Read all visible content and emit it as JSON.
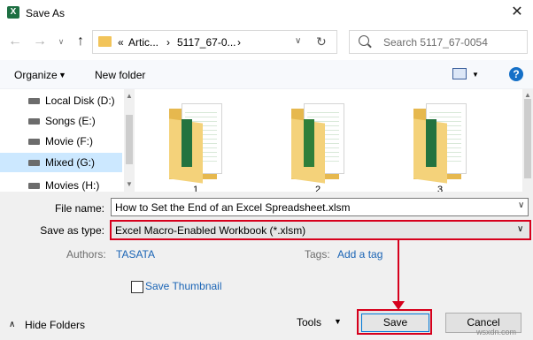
{
  "window": {
    "title": "Save As",
    "app_icon": "excel-icon",
    "close": "✕"
  },
  "nav": {
    "back": "←",
    "forward": "→",
    "recent_caret": "∨",
    "up": "↑",
    "breadcrumb": [
      "«",
      "Artic...",
      "›",
      "5117_67-0...",
      "›"
    ],
    "address_dropdown": "∨",
    "refresh": "↻",
    "search_placeholder": "Search 5117_67-0054"
  },
  "toolbar": {
    "organize": "Organize",
    "organize_caret": "▼",
    "new_folder": "New folder",
    "view_caret": "▼",
    "help": "?"
  },
  "sidebar": {
    "items": [
      {
        "label": "Local Disk (D:)",
        "icon": "drive-icon"
      },
      {
        "label": "Songs (E:)",
        "icon": "drive-icon"
      },
      {
        "label": "Movie (F:)",
        "icon": "drive-icon"
      },
      {
        "label": "Mixed (G:)",
        "icon": "drive-icon",
        "selected": true
      },
      {
        "label": "Movies (H:)",
        "icon": "drive-icon"
      }
    ]
  },
  "files": [
    {
      "label": "1"
    },
    {
      "label": "2"
    },
    {
      "label": "3"
    }
  ],
  "form": {
    "file_name_label": "File name:",
    "file_name_value": "How to Set the End of an Excel Spreadsheet.xlsm",
    "save_type_label": "Save as type:",
    "save_type_value": "Excel Macro-Enabled Workbook (*.xlsm)",
    "authors_label": "Authors:",
    "authors_value": "TASATA",
    "tags_label": "Tags:",
    "tags_value": "Add a tag",
    "save_thumbnail_label": "Save Thumbnail",
    "save_thumbnail_checked": false
  },
  "footer": {
    "hide_folders_caret": "∧",
    "hide_folders": "Hide Folders",
    "tools": "Tools",
    "tools_caret": "▼",
    "save": "Save",
    "cancel": "Cancel"
  },
  "watermark": "wsxdn.com",
  "colors": {
    "highlight": "#d6001c",
    "link": "#1a64b5",
    "selection": "#cce8ff"
  }
}
